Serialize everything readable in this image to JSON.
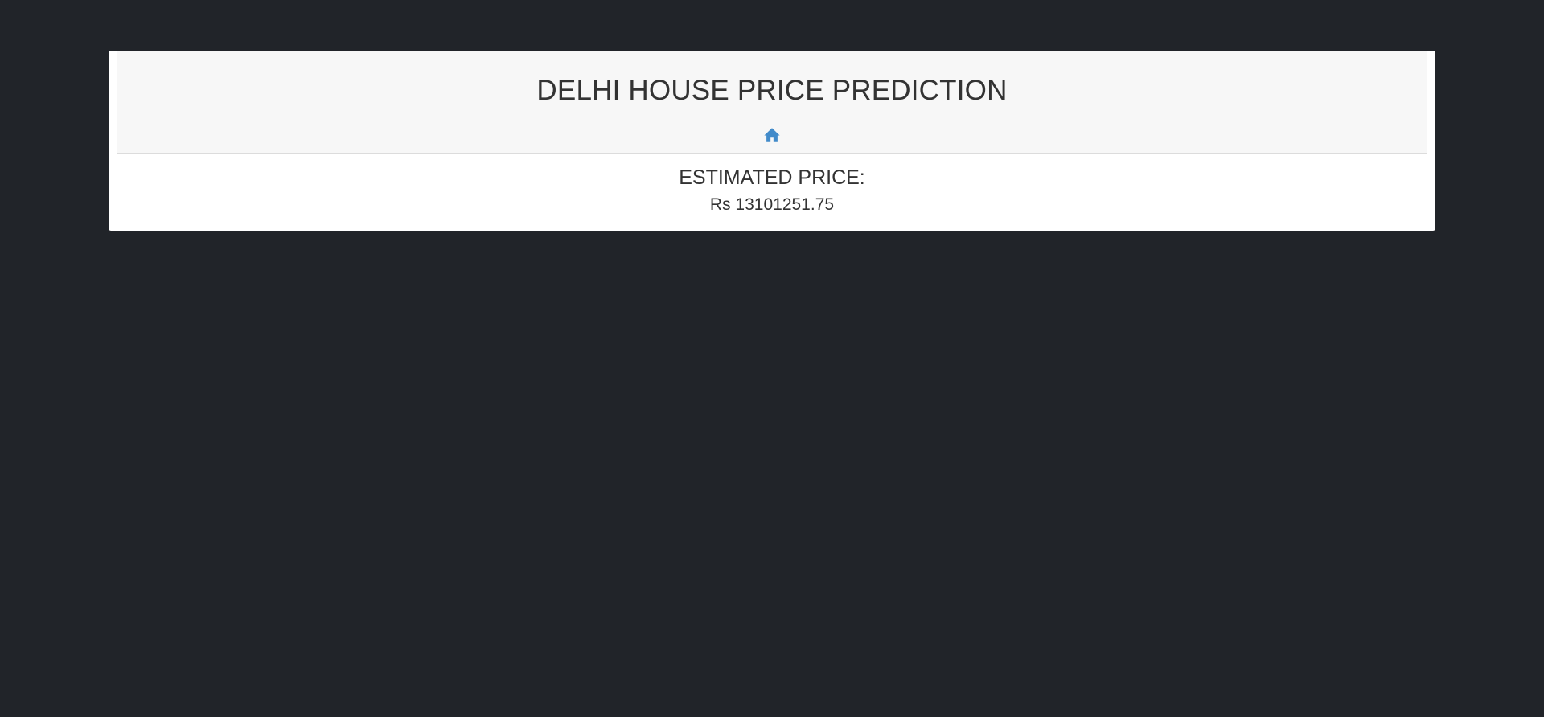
{
  "header": {
    "title": "DELHI HOUSE PRICE PREDICTION",
    "home_icon": "home-icon",
    "accent_color": "#428bca"
  },
  "result": {
    "label": "ESTIMATED PRICE:",
    "price": "Rs 13101251.75"
  }
}
